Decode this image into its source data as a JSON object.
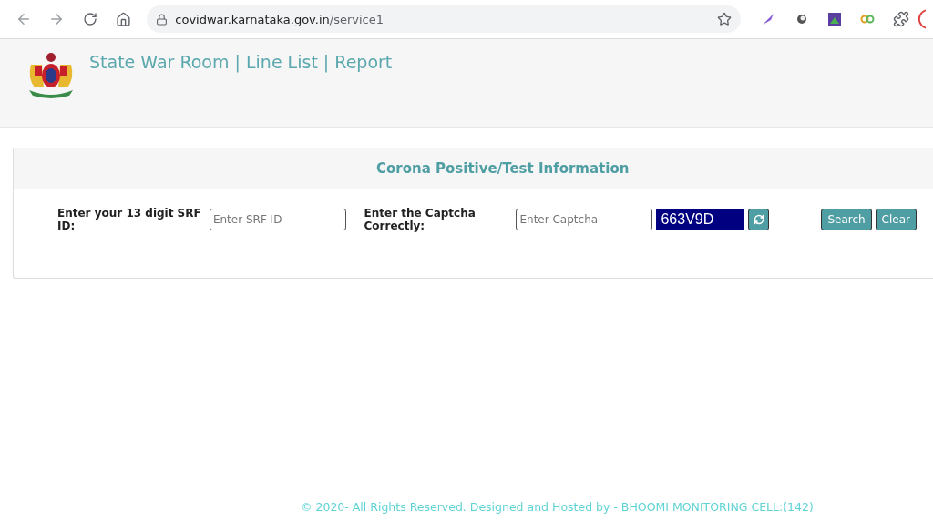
{
  "browser": {
    "url_host": "covidwar.karnataka.gov.in",
    "url_path": "/service1"
  },
  "header": {
    "title": "State War Room | Line List | Report"
  },
  "panel": {
    "title": "Corona Positive/Test Information",
    "srf_label": "Enter your 13 digit SRF ID:",
    "srf_placeholder": "Enter SRF ID",
    "captcha_label": "Enter the Captcha Correctly:",
    "captcha_placeholder": "Enter Captcha",
    "captcha_code": "663V9D",
    "buttons": [
      "Search",
      "Clear"
    ]
  },
  "footer": "© 2020- All Rights Reserved. Designed and Hosted by - BHOOMI MONITORING CELL:(142)"
}
